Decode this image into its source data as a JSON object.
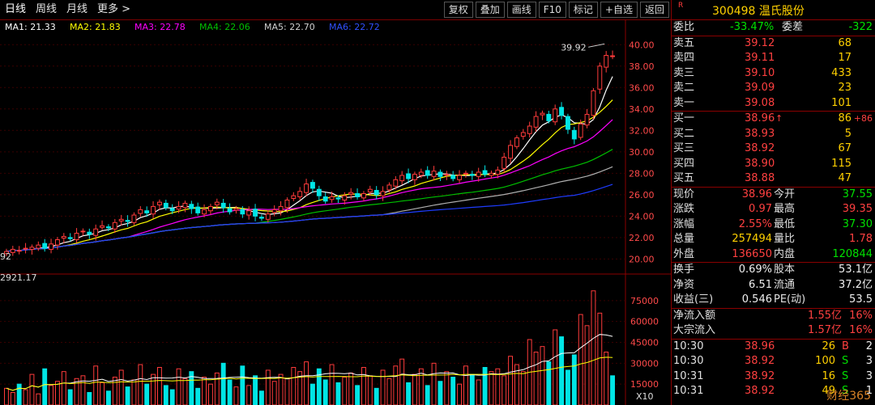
{
  "toolbar": {
    "tabs": [
      "日线",
      "周线",
      "月线",
      "更多 >"
    ],
    "buttons": [
      "复权",
      "叠加",
      "画线",
      "F10",
      "标记",
      "+自选",
      "返回"
    ]
  },
  "ma_legend": {
    "ma1": "MA1: 21.33",
    "ma2": "MA2: 21.83",
    "ma3": "MA3: 22.78",
    "ma4": "MA4: 22.06",
    "ma5": "MA5: 22.70",
    "ma6": "MA6: 22.72"
  },
  "colors": {
    "up": "#ff3b3b",
    "down": "#00e5e5",
    "ma1": "#ffffff",
    "ma2": "#ffff00",
    "ma3": "#ff00ff",
    "ma4": "#00c000",
    "ma5": "#b0b0b0",
    "ma6": "#1e3cff"
  },
  "chart_data": {
    "type": "candlestick",
    "price_axis": [
      "40.00",
      "38.00",
      "36.00",
      "34.00",
      "32.00",
      "30.00",
      "28.00",
      "26.00",
      "24.00",
      "22.00",
      "20.00"
    ],
    "price_range": [
      19.5,
      41.0
    ],
    "volume_axis": [
      "75000",
      "60000",
      "45000",
      "30000",
      "15000"
    ],
    "volume_unit_label": "X10",
    "volume_range": [
      0,
      90000
    ],
    "high_annotation": "39.92",
    "low_annotation": "92",
    "volume_annotation": "2921.17",
    "closes": [
      20.7,
      20.9,
      20.8,
      21.0,
      21.1,
      21.3,
      21.0,
      21.4,
      21.8,
      22.1,
      21.9,
      22.4,
      22.6,
      22.3,
      22.8,
      23.1,
      22.9,
      23.4,
      23.7,
      23.5,
      24.1,
      24.6,
      24.3,
      24.9,
      25.3,
      24.8,
      24.5,
      24.9,
      25.2,
      24.7,
      24.3,
      24.6,
      24.9,
      25.3,
      24.8,
      24.4,
      24.7,
      24.2,
      24.5,
      24.0,
      23.8,
      24.2,
      24.6,
      24.9,
      25.5,
      25.9,
      26.3,
      27.0,
      26.6,
      25.9,
      25.4,
      25.8,
      25.6,
      25.9,
      26.2,
      25.8,
      26.1,
      26.5,
      26.0,
      26.3,
      26.9,
      27.4,
      27.8,
      27.5,
      27.9,
      28.1,
      27.8,
      28.2,
      27.7,
      27.9,
      27.5,
      27.8,
      28.0,
      27.8,
      28.1,
      27.9,
      28.0,
      28.3,
      29.5,
      30.6,
      31.3,
      31.8,
      32.4,
      33.3,
      33.6,
      32.9,
      34.0,
      33.4,
      32.1,
      31.2,
      32.6,
      33.5,
      35.7,
      38.0,
      39.0,
      38.96
    ],
    "volumes": [
      12000,
      9000,
      15000,
      11000,
      22000,
      8000,
      26000,
      14000,
      17000,
      24000,
      11000,
      19000,
      21000,
      9000,
      28000,
      16000,
      10000,
      20000,
      25000,
      13000,
      18000,
      29000,
      15000,
      22000,
      27000,
      14000,
      11000,
      26000,
      19000,
      24000,
      12000,
      20000,
      15000,
      23000,
      30000,
      18000,
      13000,
      28000,
      14000,
      21000,
      10000,
      25000,
      17000,
      22000,
      19000,
      27000,
      24000,
      31000,
      15000,
      26000,
      18000,
      29000,
      16000,
      20000,
      23000,
      14000,
      27000,
      21000,
      12000,
      25000,
      19000,
      28000,
      33000,
      16000,
      22000,
      26000,
      14000,
      30000,
      17000,
      24000,
      20000,
      15000,
      28000,
      22000,
      18000,
      27000,
      24000,
      26000,
      21000,
      35000,
      29000,
      24000,
      47000,
      38000,
      42000,
      31000,
      54000,
      49000,
      25000,
      36000,
      65000,
      57000,
      82000,
      66000,
      38000,
      21000
    ]
  },
  "quote": {
    "r_mark": "R",
    "code": "300498 温氏股份",
    "weibi_label": "委比",
    "weibi": "-33.47%",
    "weicha_label": "委差",
    "weicha": "-322",
    "asks": [
      {
        "label": "卖五",
        "price": "39.12",
        "vol": "68"
      },
      {
        "label": "卖四",
        "price": "39.11",
        "vol": "17"
      },
      {
        "label": "卖三",
        "price": "39.10",
        "vol": "433"
      },
      {
        "label": "卖二",
        "price": "39.09",
        "vol": "23"
      },
      {
        "label": "卖一",
        "price": "39.08",
        "vol": "101"
      }
    ],
    "bids": [
      {
        "label": "买一",
        "price": "38.96",
        "arrow": "↑",
        "vol": "86",
        "chg": "+86"
      },
      {
        "label": "买二",
        "price": "38.93",
        "arrow": "",
        "vol": "5",
        "chg": ""
      },
      {
        "label": "买三",
        "price": "38.92",
        "arrow": "",
        "vol": "67",
        "chg": ""
      },
      {
        "label": "买四",
        "price": "38.90",
        "arrow": "",
        "vol": "115",
        "chg": ""
      },
      {
        "label": "买五",
        "price": "38.88",
        "arrow": "",
        "vol": "47",
        "chg": ""
      }
    ],
    "stats": [
      {
        "l1": "现价",
        "v1": "38.96",
        "c1": "red",
        "l2": "今开",
        "v2": "37.55",
        "c2": "grn"
      },
      {
        "l1": "涨跌",
        "v1": "0.97",
        "c1": "red",
        "l2": "最高",
        "v2": "39.35",
        "c2": "red"
      },
      {
        "l1": "涨幅",
        "v1": "2.55%",
        "c1": "red",
        "l2": "最低",
        "v2": "37.30",
        "c2": "grn"
      },
      {
        "l1": "总量",
        "v1": "257494",
        "c1": "yel",
        "l2": "量比",
        "v2": "1.78",
        "c2": "red"
      },
      {
        "l1": "外盘",
        "v1": "136650",
        "c1": "red",
        "l2": "内盘",
        "v2": "120844",
        "c2": "grn"
      }
    ],
    "fund": [
      {
        "l1": "换手",
        "v1": "0.69%",
        "l2": "股本",
        "v2": "53.1亿"
      },
      {
        "l1": "净资",
        "v1": "6.51",
        "l2": "流通",
        "v2": "37.2亿"
      },
      {
        "l1": "收益(三)",
        "v1": "0.546",
        "l2": "PE(动)",
        "v2": "53.5"
      }
    ],
    "flows": [
      {
        "label": "净流入额",
        "value": "1.55亿",
        "pct": "16%"
      },
      {
        "label": "大宗流入",
        "value": "1.57亿",
        "pct": "16%"
      }
    ],
    "ticks": [
      {
        "time": "10:30",
        "price": "38.96",
        "vol": "26",
        "bs": "B",
        "n": "2"
      },
      {
        "time": "10:30",
        "price": "38.92",
        "vol": "100",
        "bs": "S",
        "n": "3"
      },
      {
        "time": "10:31",
        "price": "38.92",
        "vol": "16",
        "bs": "S",
        "n": "3"
      },
      {
        "time": "10:31",
        "price": "38.92",
        "vol": "49",
        "bs": "S",
        "n": "1"
      }
    ],
    "watermark": "财经365"
  }
}
